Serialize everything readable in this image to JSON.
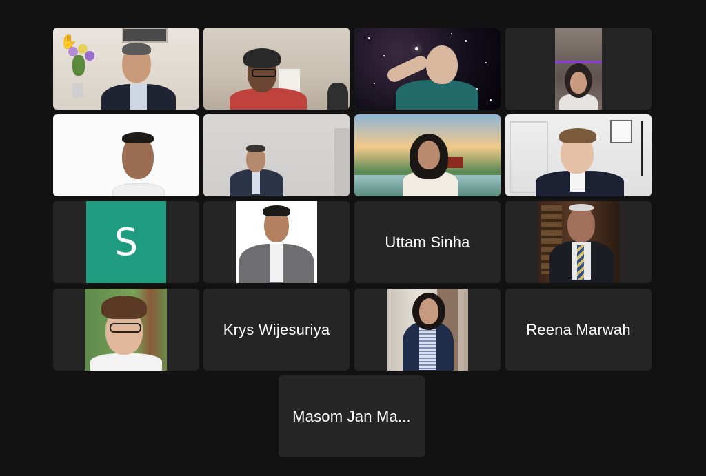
{
  "meeting": {
    "tiles": [
      {
        "type": "video",
        "name_tag": "participant-1"
      },
      {
        "type": "video",
        "name_tag": "participant-2"
      },
      {
        "type": "video",
        "name_tag": "participant-3-active-speaker"
      },
      {
        "type": "video",
        "name_tag": "participant-4"
      },
      {
        "type": "video",
        "name_tag": "participant-5"
      },
      {
        "type": "video",
        "name_tag": "participant-6"
      },
      {
        "type": "video",
        "name_tag": "participant-7"
      },
      {
        "type": "video",
        "name_tag": "participant-8"
      },
      {
        "type": "avatar",
        "initial": "S"
      },
      {
        "type": "photo",
        "name_tag": "participant-10"
      },
      {
        "type": "name",
        "label": "Uttam Sinha"
      },
      {
        "type": "photo",
        "name_tag": "participant-12"
      },
      {
        "type": "photo",
        "name_tag": "participant-13"
      },
      {
        "type": "name",
        "label": "Krys Wijesuriya"
      },
      {
        "type": "photo",
        "name_tag": "participant-15"
      },
      {
        "type": "name",
        "label": "Reena Marwah"
      },
      {
        "type": "name",
        "label": "Masom Jan Ma..."
      }
    ],
    "colors": {
      "background": "#121212",
      "tile": "#252525",
      "active_speaker_border": "#5dd166",
      "avatar_s": "#1f9b80"
    },
    "icons": [
      "raised-hand-icon"
    ]
  }
}
